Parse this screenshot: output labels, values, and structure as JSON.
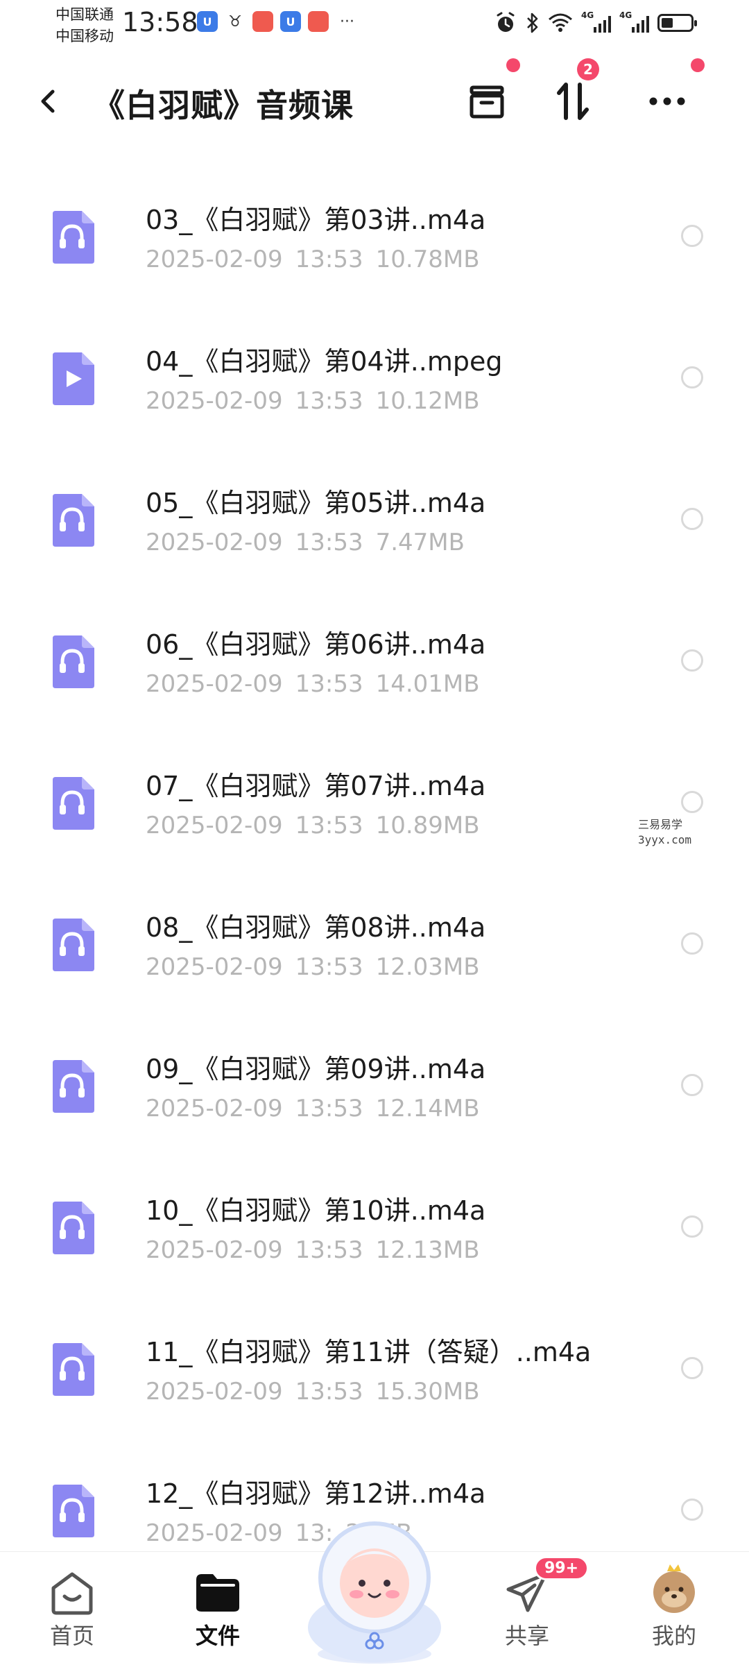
{
  "status_bar": {
    "carrier1": "中国联通",
    "carrier2": "中国移动",
    "time": "13:58",
    "more_dots": "···",
    "network_label_1": "4G",
    "network_label_2": "4G"
  },
  "header": {
    "title": "《白羽赋》音频课",
    "transfer_badge": "2"
  },
  "files": [
    {
      "name": "03_《白羽赋》第03讲..m4a",
      "date": "2025-02-09",
      "time": "13:53",
      "size": "10.78MB",
      "icon": "audio-file-icon"
    },
    {
      "name": "04_《白羽赋》第04讲..mpeg",
      "date": "2025-02-09",
      "time": "13:53",
      "size": "10.12MB",
      "icon": "video-file-icon"
    },
    {
      "name": "05_《白羽赋》第05讲..m4a",
      "date": "2025-02-09",
      "time": "13:53",
      "size": "7.47MB",
      "icon": "audio-file-icon"
    },
    {
      "name": "06_《白羽赋》第06讲..m4a",
      "date": "2025-02-09",
      "time": "13:53",
      "size": "14.01MB",
      "icon": "audio-file-icon"
    },
    {
      "name": "07_《白羽赋》第07讲..m4a",
      "date": "2025-02-09",
      "time": "13:53",
      "size": "10.89MB",
      "icon": "audio-file-icon"
    },
    {
      "name": "08_《白羽赋》第08讲..m4a",
      "date": "2025-02-09",
      "time": "13:53",
      "size": "12.03MB",
      "icon": "audio-file-icon"
    },
    {
      "name": "09_《白羽赋》第09讲..m4a",
      "date": "2025-02-09",
      "time": "13:53",
      "size": "12.14MB",
      "icon": "audio-file-icon"
    },
    {
      "name": "10_《白羽赋》第10讲..m4a",
      "date": "2025-02-09",
      "time": "13:53",
      "size": "12.13MB",
      "icon": "audio-file-icon"
    },
    {
      "name": "11_《白羽赋》第11讲（答疑）..m4a",
      "date": "2025-02-09",
      "time": "13:53",
      "size": "15.30MB",
      "icon": "audio-file-icon"
    },
    {
      "name": "12_《白羽赋》第12讲..m4a",
      "date": "2025-02-09",
      "time": "13:",
      "size": "22MB",
      "icon": "audio-file-icon"
    }
  ],
  "watermark": {
    "line1": "三易易学",
    "line2": "3yyx.com"
  },
  "bottom_nav": {
    "home": "首页",
    "files": "文件",
    "share": "共享",
    "share_badge": "99+",
    "mine": "我的"
  },
  "colors": {
    "accent_purple": "#8c87f2",
    "badge_red": "#f4486b",
    "meta_gray": "#b5b5b5"
  }
}
